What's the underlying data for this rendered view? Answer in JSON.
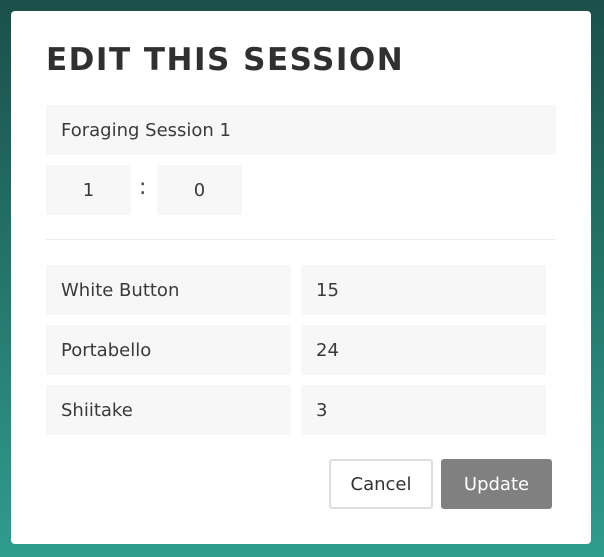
{
  "modal": {
    "title": "EDIT THIS SESSION"
  },
  "session": {
    "name": "Foraging Session 1",
    "hours": "1",
    "separator": ":",
    "minutes": "0"
  },
  "mushrooms": [
    {
      "name": "White Button",
      "count": "15"
    },
    {
      "name": "Portabello",
      "count": "24"
    },
    {
      "name": "Shiitake",
      "count": "3"
    }
  ],
  "actions": {
    "cancel_label": "Cancel",
    "update_label": "Update"
  },
  "colors": {
    "background_top": "#1b4f4a",
    "background_bottom": "#2f9c8f",
    "field_bg": "#f7f7f7",
    "update_button": "#808080"
  }
}
